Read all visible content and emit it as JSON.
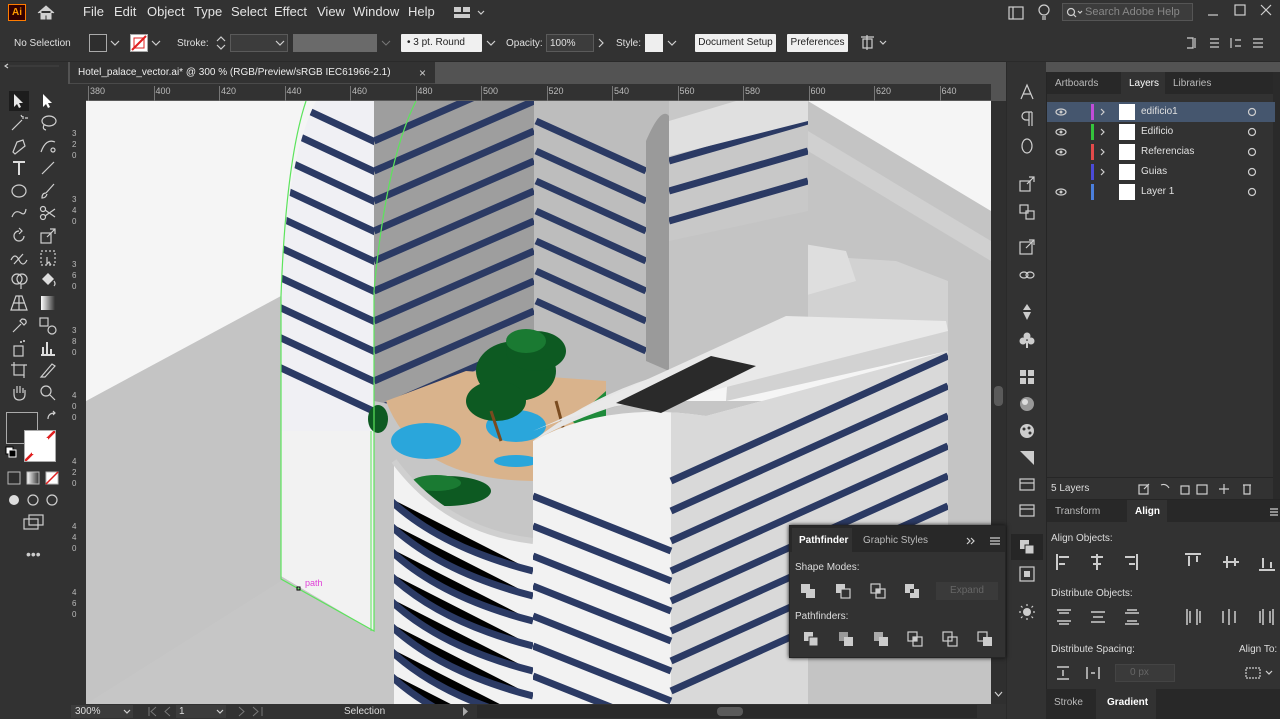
{
  "app": {
    "logo": "Ai"
  },
  "menu": [
    "File",
    "Edit",
    "Object",
    "Type",
    "Select",
    "Effect",
    "View",
    "Window",
    "Help"
  ],
  "search": {
    "placeholder": "Search Adobe Help"
  },
  "control": {
    "selection": "No Selection",
    "stroke_label": "Stroke:",
    "brush": "3 pt. Round",
    "opacity_label": "Opacity:",
    "opacity_value": "100%",
    "style_label": "Style:",
    "doc_setup": "Document Setup",
    "preferences": "Preferences"
  },
  "document": {
    "tab_title": "Hotel_palace_vector.ai* @ 300 % (RGB/Preview/sRGB IEC61966-2.1)",
    "close": "×"
  },
  "ruler_top": [
    "380",
    "400",
    "420",
    "440",
    "460",
    "480",
    "500",
    "520",
    "540",
    "560",
    "580",
    "600",
    "620",
    "640"
  ],
  "ruler_left": [
    "3\n2\n0",
    "3\n4\n0",
    "3\n6\n0",
    "3\n8\n0",
    "4\n0\n0",
    "4\n2\n0",
    "4\n4\n0",
    "4\n6\n0"
  ],
  "canvas": {
    "path_label": "path"
  },
  "status": {
    "zoom": "300%",
    "artboard": "1",
    "mode": "Selection"
  },
  "layers_panel": {
    "tabs": [
      "Artboards",
      "Layers",
      "Libraries"
    ],
    "layers": [
      {
        "name": "edificio1",
        "color": "#c14cd8",
        "selected": true
      },
      {
        "name": "Edificio",
        "color": "#34c43c",
        "selected": false
      },
      {
        "name": "Referencias",
        "color": "#e24a4a",
        "selected": false
      },
      {
        "name": "Guias",
        "color": "#4b4bd8",
        "selected": false
      },
      {
        "name": "Layer 1",
        "color": "#4b7fdc",
        "selected": false
      }
    ],
    "count": "5 Layers"
  },
  "align_panel": {
    "tabs": [
      "Transform",
      "Align"
    ],
    "align_objects": "Align Objects:",
    "distribute_objects": "Distribute Objects:",
    "distribute_spacing": "Distribute Spacing:",
    "align_to": "Align To:",
    "spacing_value": "0 px"
  },
  "bottom_tabs": [
    "Stroke",
    "Gradient"
  ],
  "pathfinder": {
    "tabs": [
      "Pathfinder",
      "Graphic Styles"
    ],
    "shape_modes": "Shape Modes:",
    "expand": "Expand",
    "pathfinders": "Pathfinders:"
  },
  "colors": {
    "stripe": "#2b3a64",
    "accent": "#4a9eff",
    "selection_green": "#5ce45c"
  }
}
